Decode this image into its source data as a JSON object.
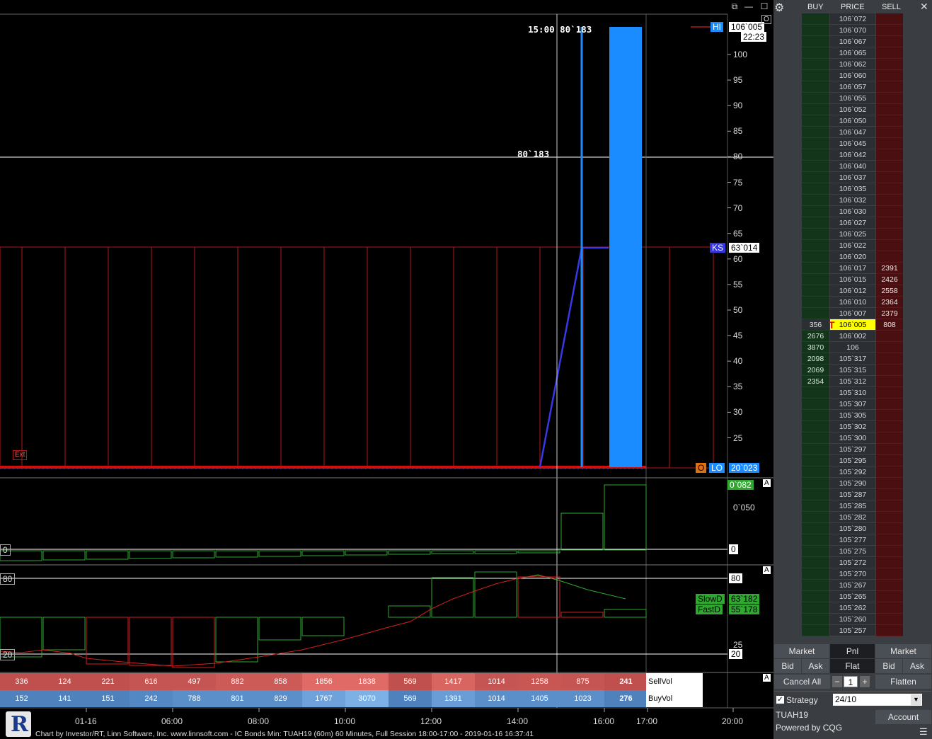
{
  "chart": {
    "top_label": "15:00  80`183",
    "mid_label": "80`183",
    "ext_label": "Ext",
    "hi_tag": "HI",
    "hi_price": "106`005",
    "countdown": "22:23",
    "ks_tag": "KS",
    "ks_price": "63`014",
    "lo_o_tag": "O",
    "lo_tag": "LO",
    "lo_price": "20`023",
    "o_corner": "O",
    "y_ticks": [
      "100",
      "95",
      "90",
      "85",
      "80",
      "75",
      "70",
      "65",
      "60",
      "55",
      "50",
      "45",
      "40",
      "35",
      "30",
      "25"
    ],
    "panel2_value": "0`082",
    "panel2_tick": "0`050",
    "panel2_zero": "0",
    "panel2_left_zero": "0",
    "panel3_top": "80",
    "panel3_bottom": "20",
    "panel3_tick25": "25",
    "panel3_left80": "80",
    "panel3_left20": "20",
    "slowd_label": "SlowD",
    "slowd_value": "63`182",
    "fastd_label": "FastD",
    "fastd_value": "55`178",
    "a_marker": "A",
    "footer": "Chart by Investor/RT, Linn Software, Inc. www.linnsoft.com - IC Bonds Min: TUAH19 (60m) 60 Minutes, Full Session 18:00-17:00 - 2019-01-16 16:37:41",
    "x_ticks": [
      "01-16",
      "06:00",
      "08:00",
      "10:00",
      "12:00",
      "14:00",
      "16:00",
      "17:00",
      "20:00"
    ]
  },
  "volume": {
    "sell_label": "SellVol",
    "buy_label": "BuyVol",
    "sell": [
      "336",
      "124",
      "221",
      "616",
      "497",
      "882",
      "858",
      "1856",
      "1838",
      "569",
      "1417",
      "1014",
      "1258",
      "875",
      "241"
    ],
    "buy": [
      "152",
      "141",
      "151",
      "242",
      "788",
      "801",
      "829",
      "1767",
      "3070",
      "569",
      "1391",
      "1014",
      "1405",
      "1023",
      "276"
    ]
  },
  "dom": {
    "headers": {
      "buy": "BUY",
      "price": "PRICE",
      "sell": "SELL"
    },
    "rows": [
      {
        "p": "106`072",
        "b": "",
        "s": ""
      },
      {
        "p": "106`070",
        "b": "",
        "s": ""
      },
      {
        "p": "106`067",
        "b": "",
        "s": ""
      },
      {
        "p": "106`065",
        "b": "",
        "s": ""
      },
      {
        "p": "106`062",
        "b": "",
        "s": ""
      },
      {
        "p": "106`060",
        "b": "",
        "s": ""
      },
      {
        "p": "106`057",
        "b": "",
        "s": ""
      },
      {
        "p": "106`055",
        "b": "",
        "s": ""
      },
      {
        "p": "106`052",
        "b": "",
        "s": ""
      },
      {
        "p": "106`050",
        "b": "",
        "s": ""
      },
      {
        "p": "106`047",
        "b": "",
        "s": ""
      },
      {
        "p": "106`045",
        "b": "",
        "s": ""
      },
      {
        "p": "106`042",
        "b": "",
        "s": ""
      },
      {
        "p": "106`040",
        "b": "",
        "s": ""
      },
      {
        "p": "106`037",
        "b": "",
        "s": ""
      },
      {
        "p": "106`035",
        "b": "",
        "s": ""
      },
      {
        "p": "106`032",
        "b": "",
        "s": ""
      },
      {
        "p": "106`030",
        "b": "",
        "s": ""
      },
      {
        "p": "106`027",
        "b": "",
        "s": ""
      },
      {
        "p": "106`025",
        "b": "",
        "s": ""
      },
      {
        "p": "106`022",
        "b": "",
        "s": ""
      },
      {
        "p": "106`020",
        "b": "",
        "s": ""
      },
      {
        "p": "106`017",
        "b": "",
        "s": "2391"
      },
      {
        "p": "106`015",
        "b": "",
        "s": "2426"
      },
      {
        "p": "106`012",
        "b": "",
        "s": "2558"
      },
      {
        "p": "106`010",
        "b": "",
        "s": "2364"
      },
      {
        "p": "106`007",
        "b": "",
        "s": "2379"
      },
      {
        "p": "106`005",
        "b": "356",
        "s": "808"
      },
      {
        "p": "106`002",
        "b": "2676",
        "s": ""
      },
      {
        "p": "106",
        "b": "3870",
        "s": ""
      },
      {
        "p": "105`317",
        "b": "2098",
        "s": ""
      },
      {
        "p": "105`315",
        "b": "2069",
        "s": ""
      },
      {
        "p": "105`312",
        "b": "2354",
        "s": ""
      },
      {
        "p": "105`310",
        "b": "",
        "s": ""
      },
      {
        "p": "105`307",
        "b": "",
        "s": ""
      },
      {
        "p": "105`305",
        "b": "",
        "s": ""
      },
      {
        "p": "105`302",
        "b": "",
        "s": ""
      },
      {
        "p": "105`300",
        "b": "",
        "s": ""
      },
      {
        "p": "105`297",
        "b": "",
        "s": ""
      },
      {
        "p": "105`295",
        "b": "",
        "s": ""
      },
      {
        "p": "105`292",
        "b": "",
        "s": ""
      },
      {
        "p": "105`290",
        "b": "",
        "s": ""
      },
      {
        "p": "105`287",
        "b": "",
        "s": ""
      },
      {
        "p": "105`285",
        "b": "",
        "s": ""
      },
      {
        "p": "105`282",
        "b": "",
        "s": ""
      },
      {
        "p": "105`280",
        "b": "",
        "s": ""
      },
      {
        "p": "105`277",
        "b": "",
        "s": ""
      },
      {
        "p": "105`275",
        "b": "",
        "s": ""
      },
      {
        "p": "105`272",
        "b": "",
        "s": ""
      },
      {
        "p": "105`270",
        "b": "",
        "s": ""
      },
      {
        "p": "105`267",
        "b": "",
        "s": ""
      },
      {
        "p": "105`265",
        "b": "",
        "s": ""
      },
      {
        "p": "105`262",
        "b": "",
        "s": ""
      },
      {
        "p": "105`260",
        "b": "",
        "s": ""
      },
      {
        "p": "105`257",
        "b": "",
        "s": ""
      }
    ],
    "buttons": {
      "market_left": "Market",
      "pnl": "Pnl",
      "market_right": "Market",
      "bid_left": "Bid",
      "ask_left": "Ask",
      "flat": "Flat",
      "bid_right": "Bid",
      "ask_right": "Ask",
      "cancel_all": "Cancel All",
      "quantity": "1",
      "flatten": "Flatten"
    },
    "strategy_label": "Strategy",
    "strategy_value": "24/10",
    "symbol": "TUAH19",
    "powered": "Powered by CQG",
    "account_button": "Account"
  },
  "colors": {
    "bar_blue": "#1a8cff",
    "ks_line": "#3535e0",
    "sell_bg": "#c0504d",
    "buy_bg": "#4f81bd"
  }
}
